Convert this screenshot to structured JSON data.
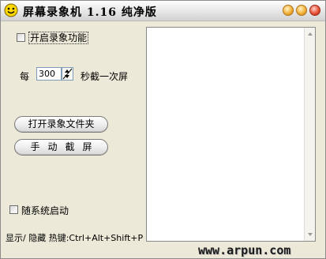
{
  "window": {
    "title": "屏幕录象机 1.16 纯净版",
    "icon": "smiley-icon",
    "controls": [
      "minimize-icon",
      "maximize-icon",
      "close-icon"
    ]
  },
  "options": {
    "record_label": "开启录象功能",
    "record_checked": false,
    "every_label": "每",
    "interval_value": "300",
    "seconds_label": "秒截一次屏",
    "startup_label": "随系统启动",
    "startup_checked": false
  },
  "buttons": {
    "open_folder": "打开录象文件夹",
    "manual_capture": "手动截屏"
  },
  "hotkey_text": "显示/ 隐藏 热键:Ctrl+Alt+Shift+P",
  "footer": {
    "url": "www.arpun.com"
  },
  "colors": {
    "window_bg": "#ece9d8",
    "close_button": "#e5533a",
    "min_max_button": "#f2b13a",
    "icon_yellow": "#ffd800"
  }
}
